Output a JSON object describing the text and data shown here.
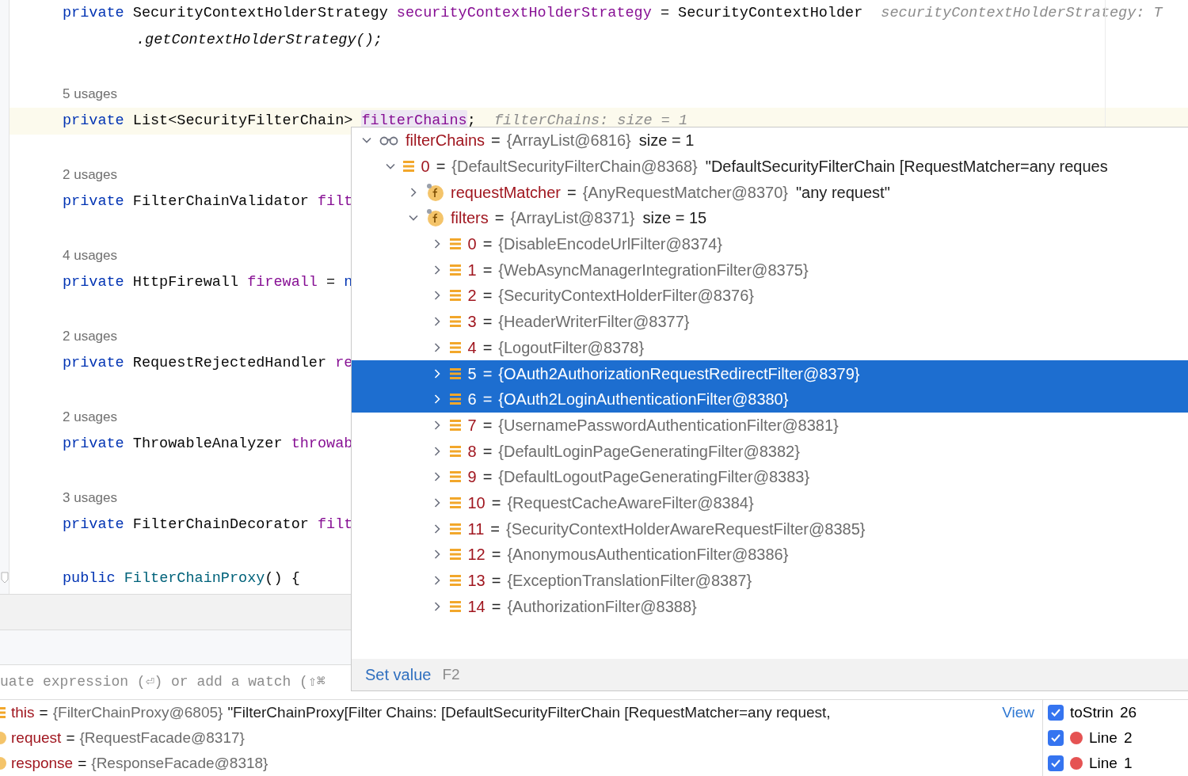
{
  "editor": {
    "lines": [
      {
        "kind": "code",
        "current": false,
        "segments": [
          {
            "text": "private",
            "kind": "keyword"
          },
          {
            "text": "SecurityContextHolderStrategy",
            "kind": "type"
          },
          {
            "text": "securityContextHolderStrategy",
            "kind": "field"
          },
          {
            "text": "=",
            "kind": "plain"
          },
          {
            "text": "SecurityContextHolder",
            "kind": "type"
          },
          {
            "text": "securityContextHolderStrategy: T",
            "kind": "hint"
          }
        ]
      },
      {
        "kind": "continuation",
        "current": false,
        "segments": [
          {
            "text": ".getContextHolderStrategy();",
            "kind": "method"
          }
        ]
      },
      {
        "kind": "blank",
        "current": false
      },
      {
        "kind": "usages",
        "current": false,
        "text": "5 usages"
      },
      {
        "kind": "code",
        "current": true,
        "segments": [
          {
            "text": "private",
            "kind": "keyword"
          },
          {
            "text": "List<SecurityFilterChain>",
            "kind": "type"
          },
          {
            "text": "filterChains",
            "kind": "marked"
          },
          {
            "text": ";",
            "kind": "glued"
          },
          {
            "text": "filterChains:  size = 1",
            "kind": "hint"
          }
        ]
      },
      {
        "kind": "blank",
        "current": false
      },
      {
        "kind": "usages",
        "current": false,
        "text": "2 usages"
      },
      {
        "kind": "code",
        "current": false,
        "segments": [
          {
            "text": "private",
            "kind": "keyword"
          },
          {
            "text": "FilterChainValidator",
            "kind": "type"
          },
          {
            "text": "filt",
            "kind": "field"
          }
        ]
      },
      {
        "kind": "blank",
        "current": false
      },
      {
        "kind": "usages",
        "current": false,
        "text": "4 usages"
      },
      {
        "kind": "code",
        "current": false,
        "segments": [
          {
            "text": "private",
            "kind": "keyword"
          },
          {
            "text": "HttpFirewall",
            "kind": "type"
          },
          {
            "text": "firewall",
            "kind": "field"
          },
          {
            "text": "=",
            "kind": "plain"
          },
          {
            "text": "n",
            "kind": "keyword"
          }
        ]
      },
      {
        "kind": "blank",
        "current": false
      },
      {
        "kind": "usages",
        "current": false,
        "text": "2 usages"
      },
      {
        "kind": "code",
        "current": false,
        "segments": [
          {
            "text": "private",
            "kind": "keyword"
          },
          {
            "text": "RequestRejectedHandler",
            "kind": "type"
          },
          {
            "text": "re",
            "kind": "field"
          }
        ]
      },
      {
        "kind": "blank",
        "current": false
      },
      {
        "kind": "usages",
        "current": false,
        "text": "2 usages"
      },
      {
        "kind": "code",
        "current": false,
        "segments": [
          {
            "text": "private",
            "kind": "keyword"
          },
          {
            "text": "ThrowableAnalyzer",
            "kind": "type"
          },
          {
            "text": "throwab",
            "kind": "field"
          }
        ]
      },
      {
        "kind": "blank",
        "current": false
      },
      {
        "kind": "usages",
        "current": false,
        "text": "3 usages"
      },
      {
        "kind": "code",
        "current": false,
        "segments": [
          {
            "text": "private",
            "kind": "keyword"
          },
          {
            "text": "FilterChainDecorator",
            "kind": "type"
          },
          {
            "text": "filt",
            "kind": "field"
          }
        ]
      },
      {
        "kind": "blank",
        "current": false
      },
      {
        "kind": "code",
        "current": false,
        "segments": [
          {
            "text": "public",
            "kind": "keyword"
          },
          {
            "text": "FilterChainProxy",
            "kind": "ctor"
          },
          {
            "text": "() {",
            "kind": "glued"
          }
        ]
      }
    ]
  },
  "popup": {
    "tree": [
      {
        "kind": "watch",
        "name": "filterChains",
        "operator": "=",
        "value": "{ArrayList@6816}",
        "extra": "size = 1",
        "expanded": true,
        "selected": false,
        "children": [
          {
            "kind": "item",
            "name": "0",
            "operator": "=",
            "value": "{DefaultSecurityFilterChain@8368}",
            "extra": "\"DefaultSecurityFilterChain [RequestMatcher=any reques",
            "expanded": true,
            "selected": false,
            "children": [
              {
                "kind": "field",
                "name": "requestMatcher",
                "operator": "=",
                "value": "{AnyRequestMatcher@8370}",
                "extra": "\"any request\"",
                "expanded": false,
                "selected": false
              },
              {
                "kind": "field",
                "name": "filters",
                "operator": "=",
                "value": "{ArrayList@8371}",
                "extra": "size = 15",
                "expanded": true,
                "selected": false,
                "children": [
                  {
                    "kind": "item",
                    "name": "0",
                    "operator": "=",
                    "value": "{DisableEncodeUrlFilter@8374}",
                    "expanded": false,
                    "selected": false
                  },
                  {
                    "kind": "item",
                    "name": "1",
                    "operator": "=",
                    "value": "{WebAsyncManagerIntegrationFilter@8375}",
                    "expanded": false,
                    "selected": false
                  },
                  {
                    "kind": "item",
                    "name": "2",
                    "operator": "=",
                    "value": "{SecurityContextHolderFilter@8376}",
                    "expanded": false,
                    "selected": false
                  },
                  {
                    "kind": "item",
                    "name": "3",
                    "operator": "=",
                    "value": "{HeaderWriterFilter@8377}",
                    "expanded": false,
                    "selected": false
                  },
                  {
                    "kind": "item",
                    "name": "4",
                    "operator": "=",
                    "value": "{LogoutFilter@8378}",
                    "expanded": false,
                    "selected": false
                  },
                  {
                    "kind": "item",
                    "name": "5",
                    "operator": "=",
                    "value": "{OAuth2AuthorizationRequestRedirectFilter@8379}",
                    "expanded": false,
                    "selected": true
                  },
                  {
                    "kind": "item",
                    "name": "6",
                    "operator": "=",
                    "value": "{OAuth2LoginAuthenticationFilter@8380}",
                    "expanded": false,
                    "selected": true
                  },
                  {
                    "kind": "item",
                    "name": "7",
                    "operator": "=",
                    "value": "{UsernamePasswordAuthenticationFilter@8381}",
                    "expanded": false,
                    "selected": false
                  },
                  {
                    "kind": "item",
                    "name": "8",
                    "operator": "=",
                    "value": "{DefaultLoginPageGeneratingFilter@8382}",
                    "expanded": false,
                    "selected": false
                  },
                  {
                    "kind": "item",
                    "name": "9",
                    "operator": "=",
                    "value": "{DefaultLogoutPageGeneratingFilter@8383}",
                    "expanded": false,
                    "selected": false
                  },
                  {
                    "kind": "item",
                    "name": "10",
                    "operator": "=",
                    "value": "{RequestCacheAwareFilter@8384}",
                    "expanded": false,
                    "selected": false
                  },
                  {
                    "kind": "item",
                    "name": "11",
                    "operator": "=",
                    "value": "{SecurityContextHolderAwareRequestFilter@8385}",
                    "expanded": false,
                    "selected": false
                  },
                  {
                    "kind": "item",
                    "name": "12",
                    "operator": "=",
                    "value": "{AnonymousAuthenticationFilter@8386}",
                    "expanded": false,
                    "selected": false
                  },
                  {
                    "kind": "item",
                    "name": "13",
                    "operator": "=",
                    "value": "{ExceptionTranslationFilter@8387}",
                    "expanded": false,
                    "selected": false
                  },
                  {
                    "kind": "item",
                    "name": "14",
                    "operator": "=",
                    "value": "{AuthorizationFilter@8388}",
                    "expanded": false,
                    "selected": false
                  }
                ]
              }
            ]
          }
        ]
      }
    ],
    "footer": {
      "action": "Set value",
      "shortcut": "F2"
    }
  },
  "debugger": {
    "eval_placeholder": "uate expression (⏎) or add a watch (⇧⌘",
    "variables": [
      {
        "kind": "object",
        "name": "this",
        "operator": "=",
        "value": "{FilterChainProxy@6805}",
        "extra": "\"FilterChainProxy[Filter Chains: [DefaultSecurityFilterChain [RequestMatcher=any request,",
        "link": "View"
      },
      {
        "kind": "param",
        "name": "request",
        "operator": "=",
        "value": "{RequestFacade@8317}"
      },
      {
        "kind": "param",
        "name": "response",
        "operator": "=",
        "value": "{ResponseFacade@8318}"
      }
    ],
    "breakpoints": [
      {
        "checked": true,
        "kind": "method",
        "label": "toStrin",
        "value": "26"
      },
      {
        "checked": true,
        "kind": "line",
        "label": "Line",
        "value": "2"
      },
      {
        "checked": true,
        "kind": "line",
        "label": "Line",
        "value": "1"
      }
    ]
  }
}
